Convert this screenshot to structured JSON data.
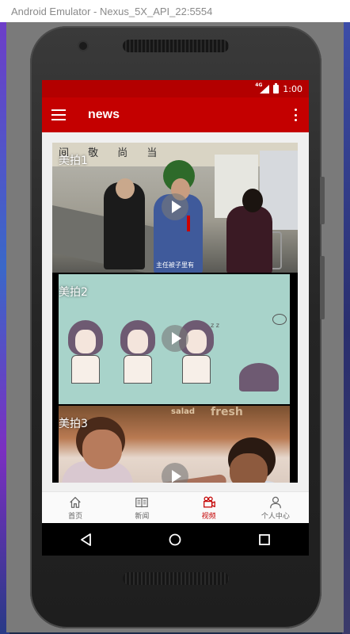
{
  "window": {
    "title": "Android Emulator - Nexus_5X_API_22:5554"
  },
  "status_bar": {
    "network": "4G",
    "time": "1:00"
  },
  "app_bar": {
    "title": "news"
  },
  "videos": [
    {
      "title": "美拍1",
      "subtitle": "主任被子里有"
    },
    {
      "title": "美拍2"
    },
    {
      "title": "美拍3"
    }
  ],
  "bottom_nav": [
    {
      "label": "首页",
      "icon": "home-icon",
      "active": false
    },
    {
      "label": "新闻",
      "icon": "newspaper-icon",
      "active": false
    },
    {
      "label": "视频",
      "icon": "video-camera-icon",
      "active": true
    },
    {
      "label": "个人中心",
      "icon": "person-icon",
      "active": false
    }
  ],
  "colors": {
    "primary": "#c40000",
    "status_bar": "#b30000",
    "inactive_nav": "#666666"
  }
}
